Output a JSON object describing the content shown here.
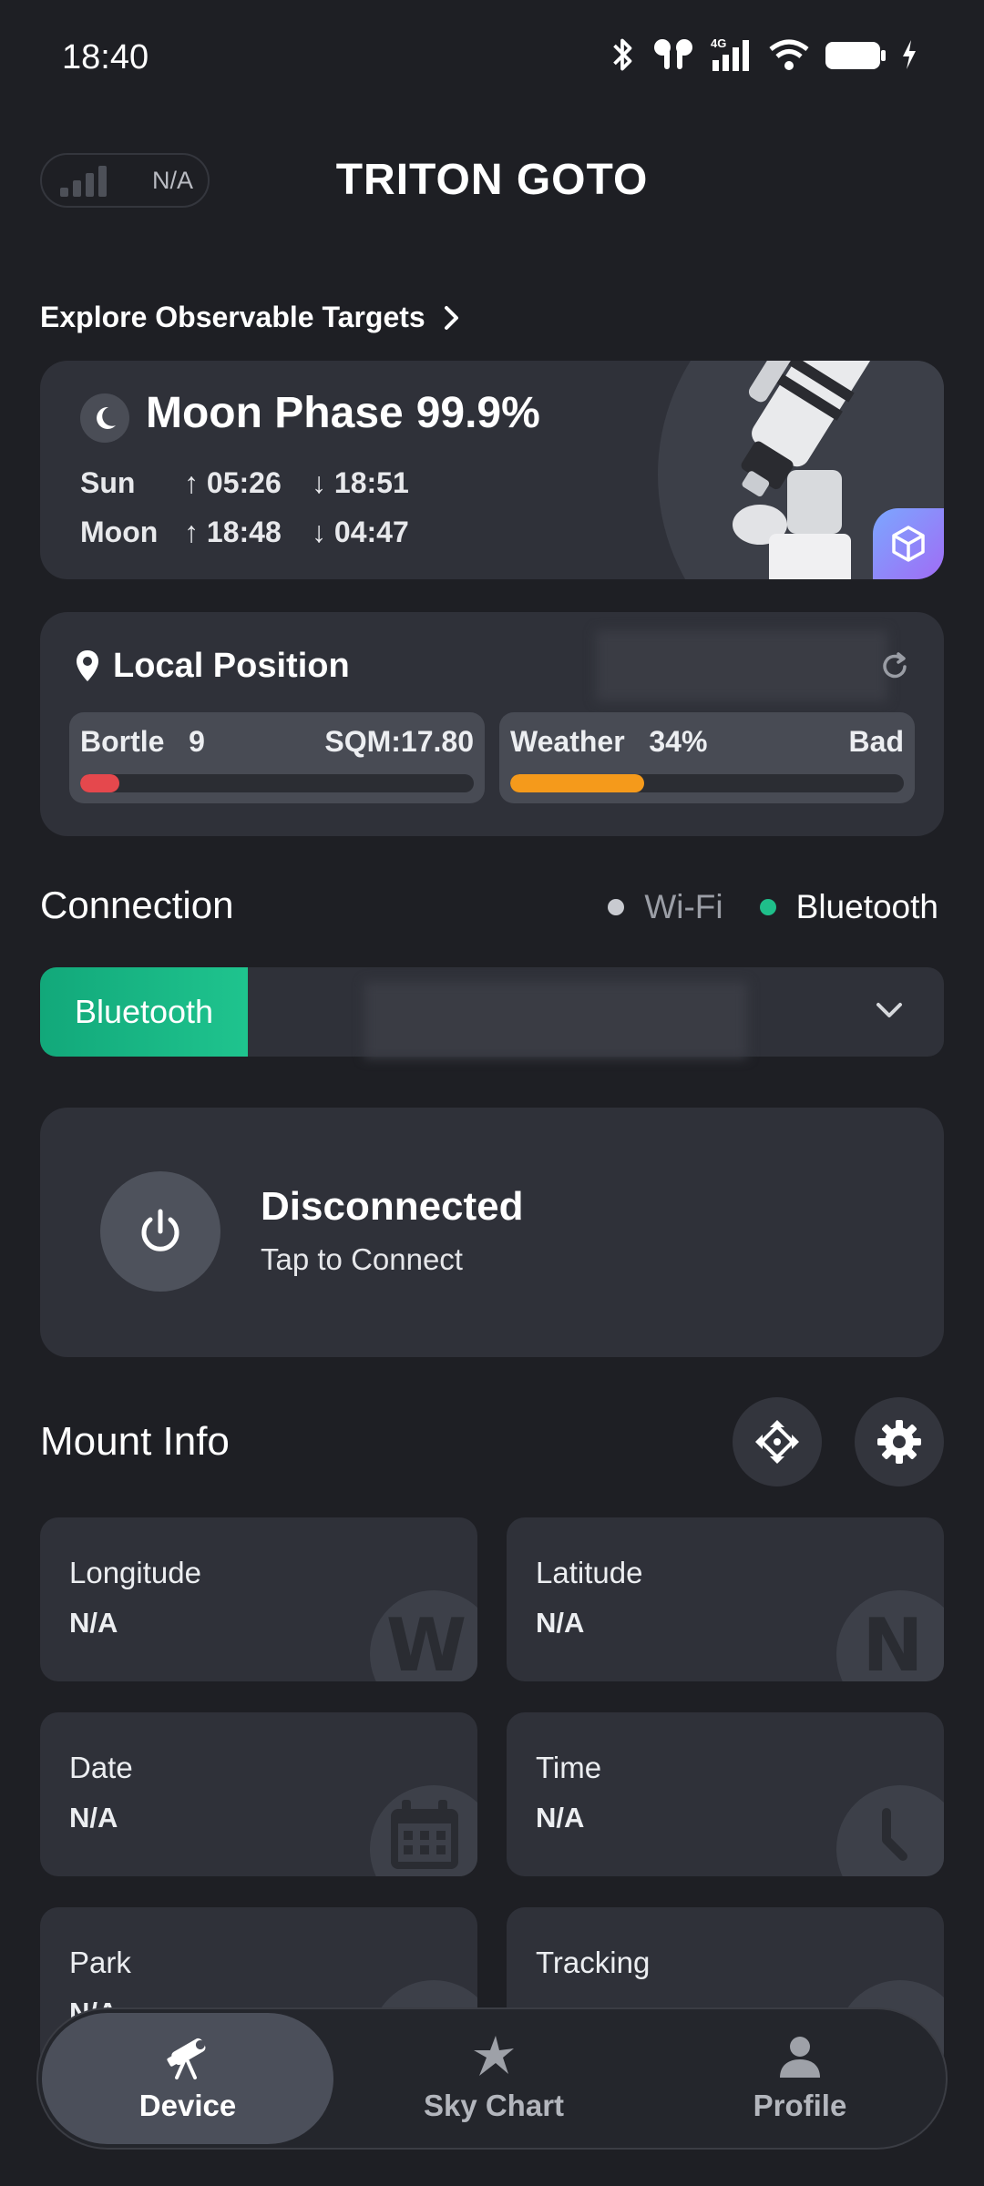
{
  "status_bar": {
    "time": "18:40",
    "network": "4G"
  },
  "header": {
    "signal_text": "N/A",
    "title": "TRITON GOTO"
  },
  "explore": {
    "label": "Explore Observable Targets"
  },
  "moon_card": {
    "title": "Moon Phase",
    "percent": "99.9%",
    "sun": {
      "label": "Sun",
      "rise": "↑ 05:26",
      "set": "↓ 18:51"
    },
    "moon": {
      "label": "Moon",
      "rise": "↑ 18:48",
      "set": "↓ 04:47"
    }
  },
  "position": {
    "title": "Local Position",
    "bortle": {
      "label": "Bortle",
      "value": "9",
      "sqm": "SQM:17.80",
      "level": 0.1,
      "color": "#e5484d"
    },
    "weather": {
      "label": "Weather",
      "value": "34%",
      "status": "Bad",
      "level": 0.34,
      "color": "#f59a1b"
    }
  },
  "connection": {
    "title": "Connection",
    "options": {
      "wifi": "Wi-Fi",
      "bluetooth": "Bluetooth"
    },
    "selected_type": "Bluetooth",
    "status": "Disconnected",
    "hint": "Tap to Connect",
    "accent": "#1fbf8a"
  },
  "mount": {
    "title": "Mount Info",
    "tiles": [
      {
        "label": "Longitude",
        "value": "N/A",
        "icon": "W"
      },
      {
        "label": "Latitude",
        "value": "N/A",
        "icon": "N"
      },
      {
        "label": "Date",
        "value": "N/A",
        "icon": "calendar-icon"
      },
      {
        "label": "Time",
        "value": "N/A",
        "icon": "clock-icon"
      },
      {
        "label": "Park",
        "value": "N/A",
        "icon": "park-icon"
      },
      {
        "label": "Tracking",
        "value": "",
        "icon": "tracking-icon"
      }
    ]
  },
  "nav": {
    "items": [
      {
        "label": "Device",
        "icon": "telescope-icon",
        "active": true
      },
      {
        "label": "Sky Chart",
        "icon": "star-icon",
        "active": false
      },
      {
        "label": "Profile",
        "icon": "person-icon",
        "active": false
      }
    ]
  }
}
